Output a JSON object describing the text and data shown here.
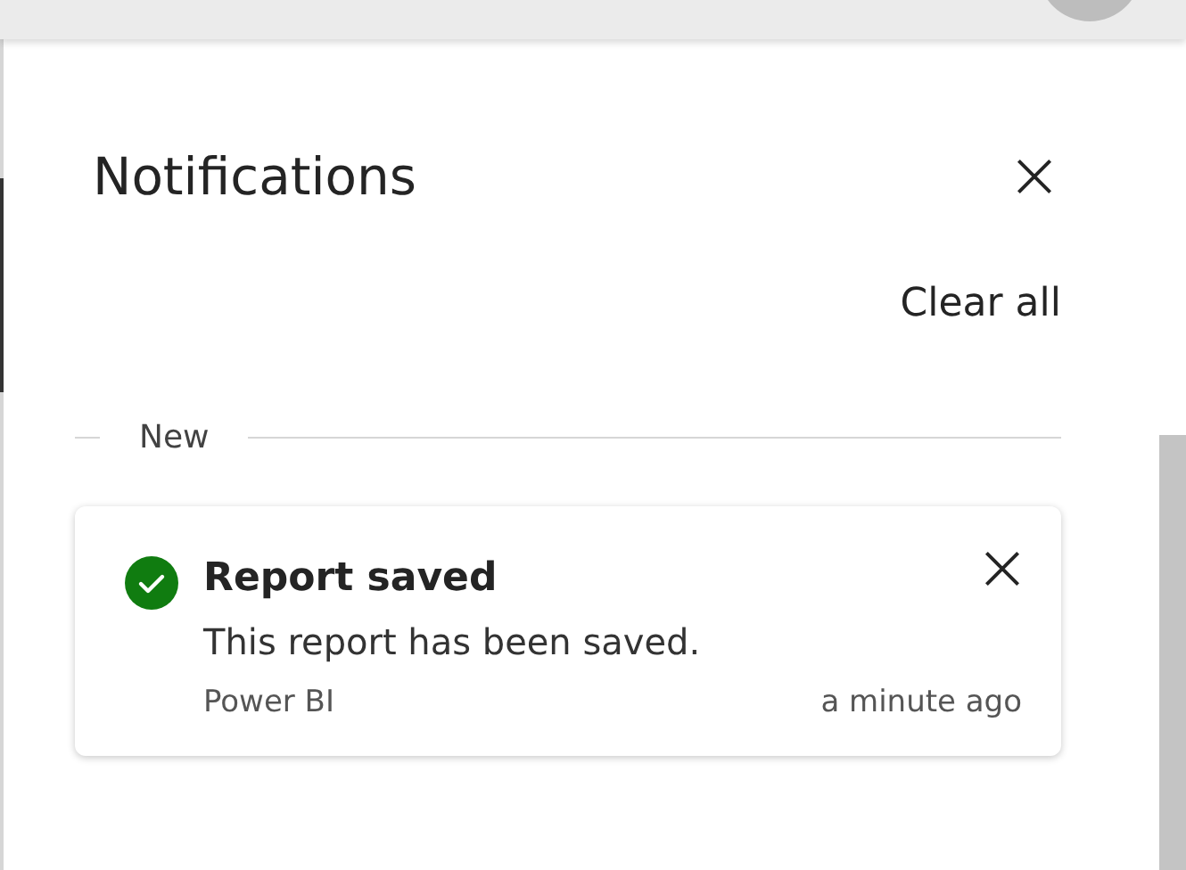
{
  "panel": {
    "title": "Notifications",
    "clear_all": "Clear all"
  },
  "sections": [
    {
      "label": "New",
      "notifications": [
        {
          "kind": "success",
          "title": "Report saved",
          "message": "This report has been saved.",
          "source": "Power BI",
          "time": "a minute ago"
        }
      ]
    }
  ]
}
